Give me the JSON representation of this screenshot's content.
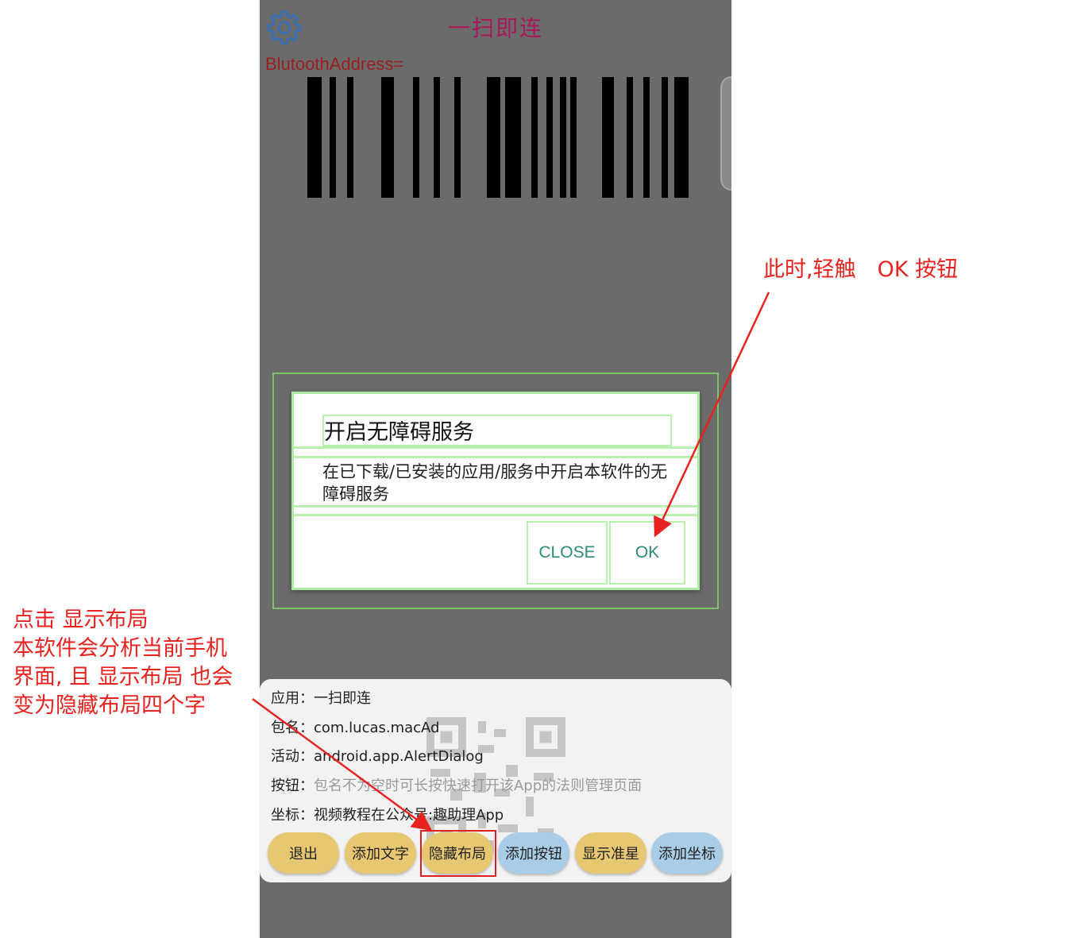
{
  "app": {
    "title": "一扫即连",
    "bluetooth_address_label": "BlutoothAddress="
  },
  "dialog": {
    "title": "开启无障碍服务",
    "message": "在已下载/已安装的应用/服务中开启本软件的无障碍服务",
    "close_label": "CLOSE",
    "ok_label": "OK",
    "accent_color": "#2e8b77"
  },
  "panel": {
    "info": [
      {
        "key": "应用：",
        "value": "一扫即连"
      },
      {
        "key": "包名：",
        "value": "com.lucas.macAd"
      },
      {
        "key": "活动：",
        "value": "android.app.AlertDialog"
      },
      {
        "key": "按钮：",
        "value": "包名不为空时可长按快速打开该App的法则管理页面"
      },
      {
        "key": "坐标：",
        "value": "视频教程在公众号:趣助理App"
      }
    ],
    "buttons": [
      {
        "label": "退出",
        "style": "gold"
      },
      {
        "label": "添加文字",
        "style": "gold"
      },
      {
        "label": "隐藏布局",
        "style": "gold"
      },
      {
        "label": "添加按钮",
        "style": "blue"
      },
      {
        "label": "显示准星",
        "style": "gold"
      },
      {
        "label": "添加坐标",
        "style": "blue"
      }
    ]
  },
  "annotations": {
    "right_note": "此时,轻触　OK  按钮",
    "left_note_lines": [
      "点击  显示布局",
      "本软件会分析当前手机",
      "界面, 且 显示布局 也会",
      "变为隐藏布局四个字"
    ],
    "color": "#e8231f"
  }
}
